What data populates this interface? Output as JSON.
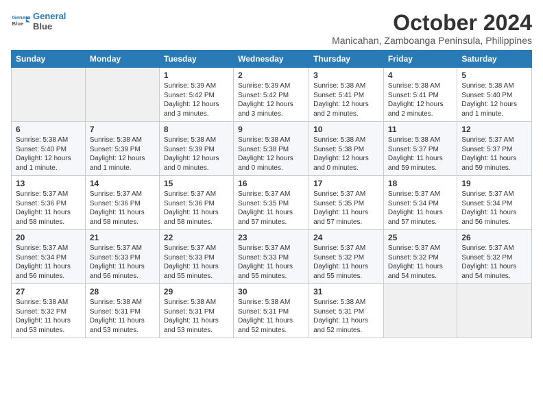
{
  "logo": {
    "line1": "General",
    "line2": "Blue"
  },
  "title": "October 2024",
  "subtitle": "Manicahan, Zamboanga Peninsula, Philippines",
  "days_of_week": [
    "Sunday",
    "Monday",
    "Tuesday",
    "Wednesday",
    "Thursday",
    "Friday",
    "Saturday"
  ],
  "weeks": [
    [
      {
        "day": "",
        "info": ""
      },
      {
        "day": "",
        "info": ""
      },
      {
        "day": "1",
        "info": "Sunrise: 5:39 AM\nSunset: 5:42 PM\nDaylight: 12 hours and 3 minutes."
      },
      {
        "day": "2",
        "info": "Sunrise: 5:39 AM\nSunset: 5:42 PM\nDaylight: 12 hours and 3 minutes."
      },
      {
        "day": "3",
        "info": "Sunrise: 5:38 AM\nSunset: 5:41 PM\nDaylight: 12 hours and 2 minutes."
      },
      {
        "day": "4",
        "info": "Sunrise: 5:38 AM\nSunset: 5:41 PM\nDaylight: 12 hours and 2 minutes."
      },
      {
        "day": "5",
        "info": "Sunrise: 5:38 AM\nSunset: 5:40 PM\nDaylight: 12 hours and 1 minute."
      }
    ],
    [
      {
        "day": "6",
        "info": "Sunrise: 5:38 AM\nSunset: 5:40 PM\nDaylight: 12 hours and 1 minute."
      },
      {
        "day": "7",
        "info": "Sunrise: 5:38 AM\nSunset: 5:39 PM\nDaylight: 12 hours and 1 minute."
      },
      {
        "day": "8",
        "info": "Sunrise: 5:38 AM\nSunset: 5:39 PM\nDaylight: 12 hours and 0 minutes."
      },
      {
        "day": "9",
        "info": "Sunrise: 5:38 AM\nSunset: 5:38 PM\nDaylight: 12 hours and 0 minutes."
      },
      {
        "day": "10",
        "info": "Sunrise: 5:38 AM\nSunset: 5:38 PM\nDaylight: 12 hours and 0 minutes."
      },
      {
        "day": "11",
        "info": "Sunrise: 5:38 AM\nSunset: 5:37 PM\nDaylight: 11 hours and 59 minutes."
      },
      {
        "day": "12",
        "info": "Sunrise: 5:37 AM\nSunset: 5:37 PM\nDaylight: 11 hours and 59 minutes."
      }
    ],
    [
      {
        "day": "13",
        "info": "Sunrise: 5:37 AM\nSunset: 5:36 PM\nDaylight: 11 hours and 58 minutes."
      },
      {
        "day": "14",
        "info": "Sunrise: 5:37 AM\nSunset: 5:36 PM\nDaylight: 11 hours and 58 minutes."
      },
      {
        "day": "15",
        "info": "Sunrise: 5:37 AM\nSunset: 5:36 PM\nDaylight: 11 hours and 58 minutes."
      },
      {
        "day": "16",
        "info": "Sunrise: 5:37 AM\nSunset: 5:35 PM\nDaylight: 11 hours and 57 minutes."
      },
      {
        "day": "17",
        "info": "Sunrise: 5:37 AM\nSunset: 5:35 PM\nDaylight: 11 hours and 57 minutes."
      },
      {
        "day": "18",
        "info": "Sunrise: 5:37 AM\nSunset: 5:34 PM\nDaylight: 11 hours and 57 minutes."
      },
      {
        "day": "19",
        "info": "Sunrise: 5:37 AM\nSunset: 5:34 PM\nDaylight: 11 hours and 56 minutes."
      }
    ],
    [
      {
        "day": "20",
        "info": "Sunrise: 5:37 AM\nSunset: 5:34 PM\nDaylight: 11 hours and 56 minutes."
      },
      {
        "day": "21",
        "info": "Sunrise: 5:37 AM\nSunset: 5:33 PM\nDaylight: 11 hours and 56 minutes."
      },
      {
        "day": "22",
        "info": "Sunrise: 5:37 AM\nSunset: 5:33 PM\nDaylight: 11 hours and 55 minutes."
      },
      {
        "day": "23",
        "info": "Sunrise: 5:37 AM\nSunset: 5:33 PM\nDaylight: 11 hours and 55 minutes."
      },
      {
        "day": "24",
        "info": "Sunrise: 5:37 AM\nSunset: 5:32 PM\nDaylight: 11 hours and 55 minutes."
      },
      {
        "day": "25",
        "info": "Sunrise: 5:37 AM\nSunset: 5:32 PM\nDaylight: 11 hours and 54 minutes."
      },
      {
        "day": "26",
        "info": "Sunrise: 5:37 AM\nSunset: 5:32 PM\nDaylight: 11 hours and 54 minutes."
      }
    ],
    [
      {
        "day": "27",
        "info": "Sunrise: 5:38 AM\nSunset: 5:32 PM\nDaylight: 11 hours and 53 minutes."
      },
      {
        "day": "28",
        "info": "Sunrise: 5:38 AM\nSunset: 5:31 PM\nDaylight: 11 hours and 53 minutes."
      },
      {
        "day": "29",
        "info": "Sunrise: 5:38 AM\nSunset: 5:31 PM\nDaylight: 11 hours and 53 minutes."
      },
      {
        "day": "30",
        "info": "Sunrise: 5:38 AM\nSunset: 5:31 PM\nDaylight: 11 hours and 52 minutes."
      },
      {
        "day": "31",
        "info": "Sunrise: 5:38 AM\nSunset: 5:31 PM\nDaylight: 11 hours and 52 minutes."
      },
      {
        "day": "",
        "info": ""
      },
      {
        "day": "",
        "info": ""
      }
    ]
  ]
}
